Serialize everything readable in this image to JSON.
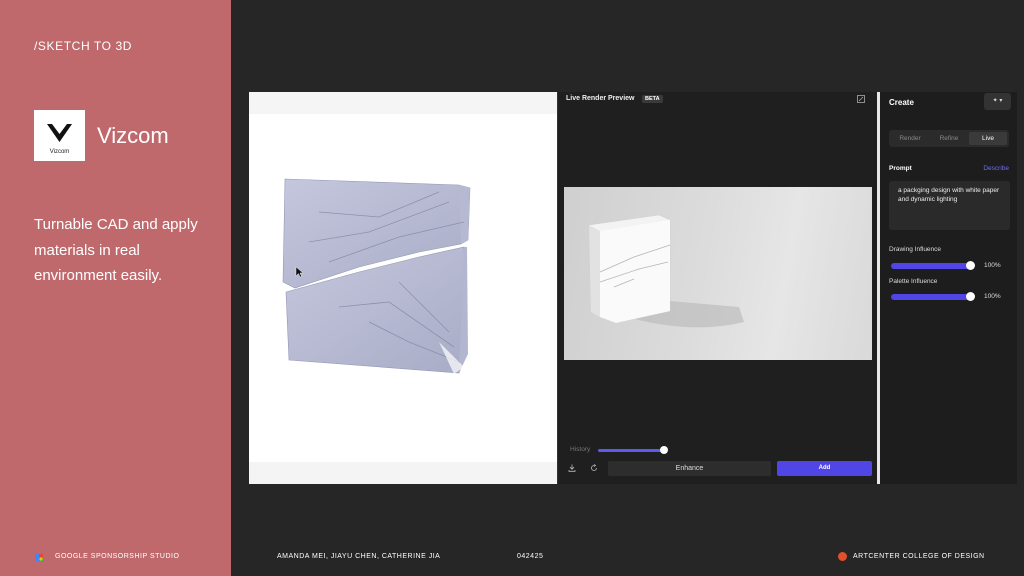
{
  "sidebar": {
    "section_label": "/SKETCH TO 3D",
    "logo_text": "Vizcom",
    "brand_name": "Vizcom",
    "description": "Turnable CAD and apply materials in real environment easily."
  },
  "preview": {
    "title": "Live Render Preview",
    "badge": "BETA",
    "history_label": "History",
    "history_value": 0.85,
    "enhance_label": "Enhance",
    "add_label": "Add"
  },
  "panel": {
    "title": "Create",
    "tabs": [
      {
        "label": "Render",
        "active": false
      },
      {
        "label": "Refine",
        "active": false
      },
      {
        "label": "Live",
        "active": true
      }
    ],
    "prompt_label": "Prompt",
    "describe_label": "Describe",
    "prompt_text": "a packging design with white paper and dynamic lighting",
    "sliders": [
      {
        "label": "Drawing Influence",
        "value": "100%"
      },
      {
        "label": "Palette Influence",
        "value": "100%"
      }
    ]
  },
  "footer": {
    "studio": "GOOGLE SPONSORSHIP STUDIO",
    "authors": "AMANDA MEI, JIAYU CHEN, CATHERINE JIA",
    "date": "042425",
    "college": "ARTCENTER COLLEGE OF DESIGN"
  },
  "colors": {
    "side_panel": "#c0696d",
    "background": "#262626",
    "accent": "#4f46e5",
    "college_dot": "#e0502a"
  }
}
